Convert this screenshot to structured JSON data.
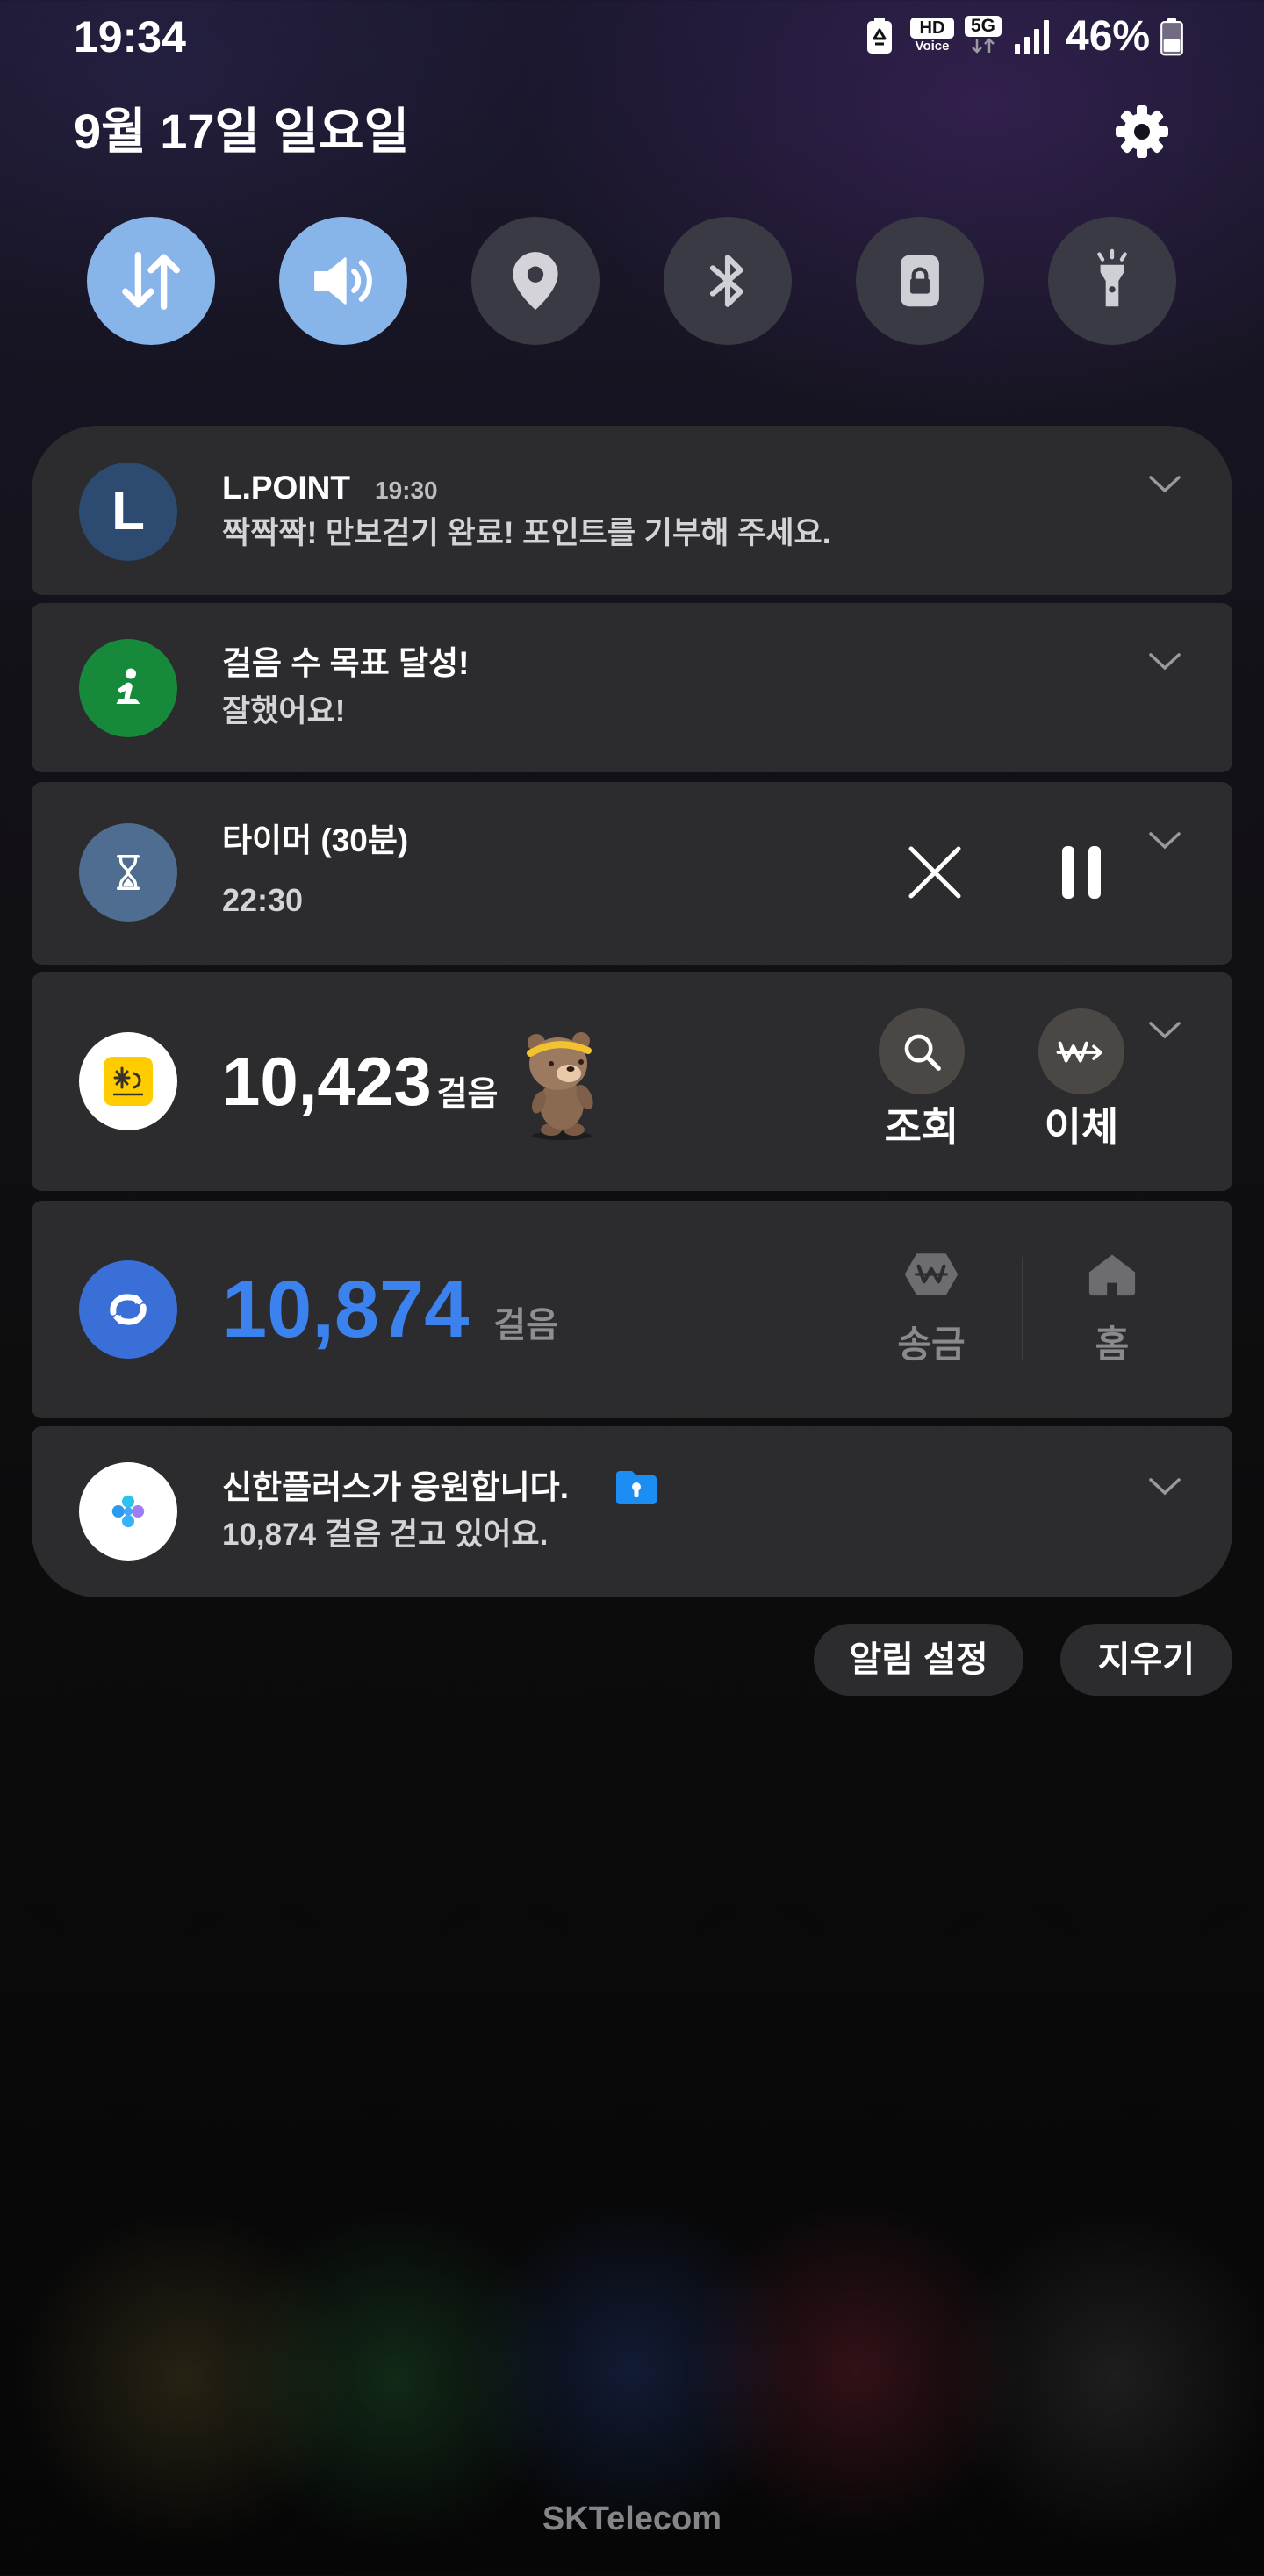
{
  "status_bar": {
    "time": "19:34",
    "hd_voice": {
      "top": "HD",
      "bottom": "Voice"
    },
    "network": "5G",
    "battery_percent": "46%",
    "icons": [
      "battery-saver-icon",
      "hd-voice-icon",
      "5g-data-icon",
      "signal-icon",
      "battery-icon"
    ]
  },
  "header": {
    "date": "9월 17일 일요일",
    "settings_icon": "gear-icon"
  },
  "quick_settings": [
    {
      "id": "mobile-data",
      "icon": "data-arrows-icon",
      "active": true
    },
    {
      "id": "sound",
      "icon": "speaker-icon",
      "active": true
    },
    {
      "id": "location",
      "icon": "location-pin-icon",
      "active": false
    },
    {
      "id": "bluetooth",
      "icon": "bluetooth-icon",
      "active": false
    },
    {
      "id": "screen-lock",
      "icon": "lock-icon",
      "active": false
    },
    {
      "id": "flashlight",
      "icon": "flashlight-icon",
      "active": false
    }
  ],
  "notifications": {
    "lpoint": {
      "icon_letter": "L",
      "app_name": "L.POINT",
      "time": "19:30",
      "message": "짝짝짝! 만보걷기 완료! 포인트를 기부해 주세요."
    },
    "step_goal": {
      "icon": "stretching-person-icon",
      "title": "걸음 수 목표 달성!",
      "message": "잘했어요!"
    },
    "timer": {
      "icon": "hourglass-icon",
      "title": "타이머 (30분)",
      "remaining": "22:30",
      "actions": [
        "close-icon",
        "pause-icon"
      ]
    },
    "kb_steps": {
      "steps": "10,423",
      "unit": "걸음",
      "buttons": [
        {
          "label": "조회",
          "icon": "search-icon"
        },
        {
          "label": "이체",
          "icon": "transfer-icon"
        }
      ]
    },
    "shinhan_steps": {
      "steps": "10,874",
      "unit": "걸음",
      "buttons": [
        {
          "label": "송금",
          "icon": "won-send-icon"
        },
        {
          "label": "홈",
          "icon": "home-icon"
        }
      ]
    },
    "shinhan_plus": {
      "title": "신한플러스가 응원합니다.",
      "message": "10,874 걸음 걷고 있어요.",
      "badge_icon": "secure-folder-icon"
    }
  },
  "panel_actions": {
    "settings_label": "알림 설정",
    "clear_label": "지우기"
  },
  "carrier": "SKTelecom",
  "colors": {
    "toggle_active": "#87b5ea",
    "toggle_inactive": "#3a3a44",
    "card_background": "#2c2c2f",
    "steps_blue": "#3b82ee",
    "lpoint_icon": "#2d4a70",
    "step_goal_icon": "#17893a",
    "timer_icon": "#4e6d90",
    "kb_yellow": "#ffcc00",
    "shinhan_blue": "#3b6fd8",
    "secure_folder_blue": "#1b8df3"
  }
}
